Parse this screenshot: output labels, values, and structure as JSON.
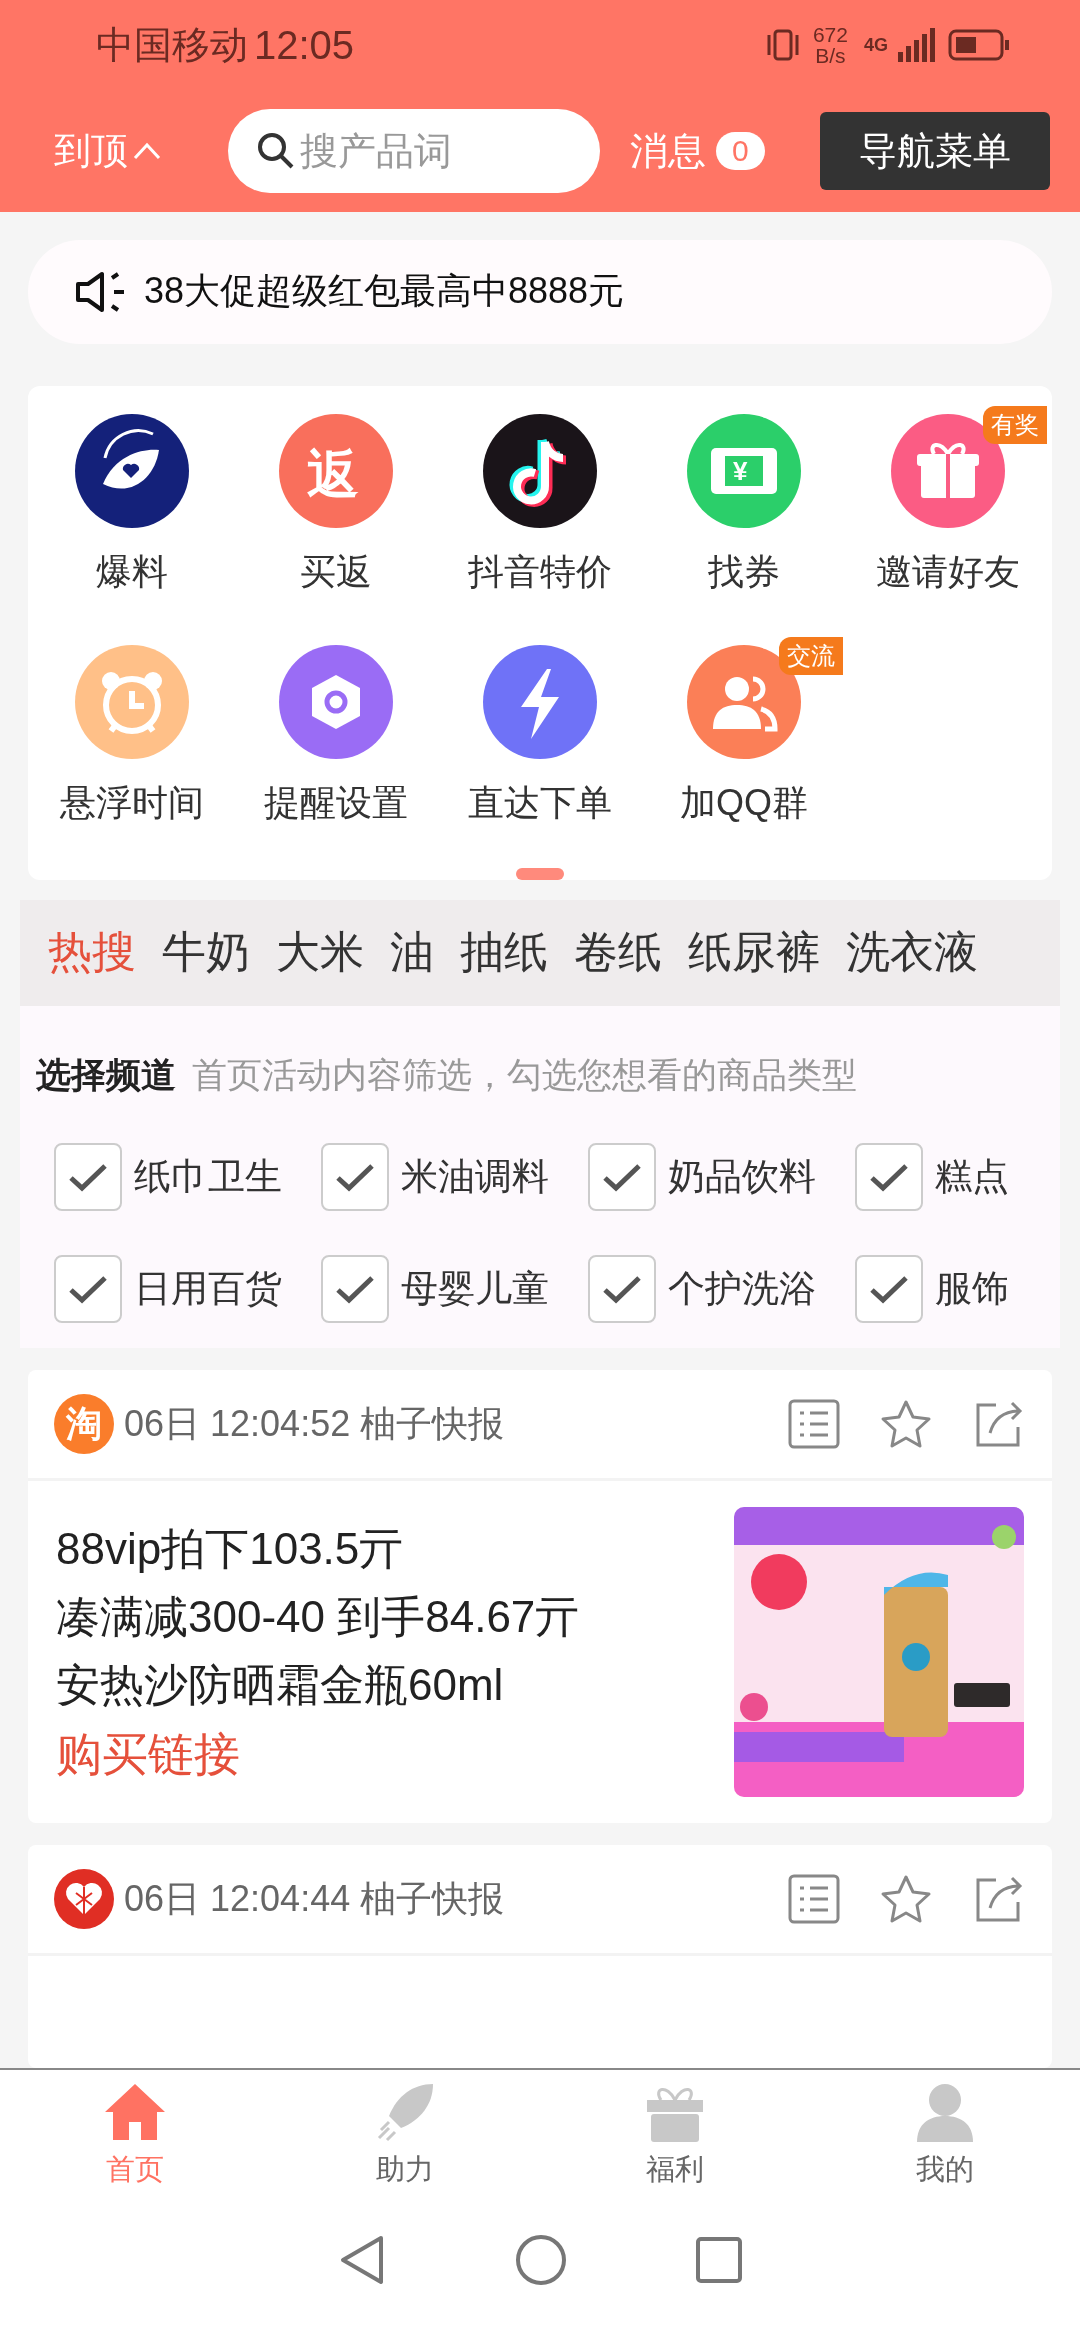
{
  "status_bar": {
    "carrier": "中国移动",
    "time": "12:05",
    "net_speed": "672",
    "net_unit": "B/s",
    "network": "4G"
  },
  "header": {
    "back_to_top": "到顶",
    "search": {
      "placeholder": "搜产品词"
    },
    "messages": {
      "label": "消息",
      "count": "0"
    },
    "nav_menu": "导航菜单"
  },
  "notice": "38大促超级红包最高中8888元",
  "shortcuts": [
    {
      "kind": "eye",
      "label": "爆料"
    },
    {
      "kind": "rebate",
      "label": "买返",
      "glyph": "返"
    },
    {
      "kind": "note",
      "label": "抖音特价"
    },
    {
      "kind": "ticket",
      "label": "找券",
      "glyph": "¥"
    },
    {
      "kind": "gift",
      "label": "邀请好友",
      "badge": "有奖"
    },
    {
      "kind": "clock",
      "label": "悬浮时间"
    },
    {
      "kind": "hexagon",
      "label": "提醒设置"
    },
    {
      "kind": "bolt",
      "label": "直达下单"
    },
    {
      "kind": "group",
      "label": "加QQ群",
      "badge": "交流"
    }
  ],
  "hot_search": {
    "label": "热搜",
    "terms": [
      "牛奶",
      "大米",
      "油",
      "抽纸",
      "卷纸",
      "纸尿裤",
      "洗衣液"
    ]
  },
  "channels": {
    "title": "选择频道",
    "hint": "首页活动内容筛选，勾选您想看的商品类型",
    "items": [
      {
        "label": "纸巾卫生",
        "checked": true
      },
      {
        "label": "米油调料",
        "checked": true
      },
      {
        "label": "奶品饮料",
        "checked": true
      },
      {
        "label": "糕点",
        "checked": true
      },
      {
        "label": "日用百货",
        "checked": true
      },
      {
        "label": "母婴儿童",
        "checked": true
      },
      {
        "label": "个护洗浴",
        "checked": true
      },
      {
        "label": "服饰",
        "checked": true
      }
    ]
  },
  "posts": [
    {
      "kind": "letter",
      "source_badge": "淘",
      "date": "06日",
      "time": "12:04:52",
      "author": "柚子快报",
      "lines": [
        "88vip拍下103.5亓",
        "凑满减300-40 到手84.67亓",
        "安热沙防晒霜金瓶60ml"
      ],
      "link": "购买链接",
      "image": {
        "kind": "picture"
      }
    },
    {
      "kind": "heart",
      "date": "06日",
      "time": "12:04:44",
      "author": "柚子快报"
    }
  ],
  "tab_bar": [
    {
      "kind": "home",
      "label": "首页",
      "selected": true
    },
    {
      "kind": "rocket",
      "label": "助力",
      "selected": false
    },
    {
      "kind": "gift",
      "label": "福利",
      "selected": false
    },
    {
      "kind": "person",
      "label": "我的",
      "selected": false
    }
  ]
}
